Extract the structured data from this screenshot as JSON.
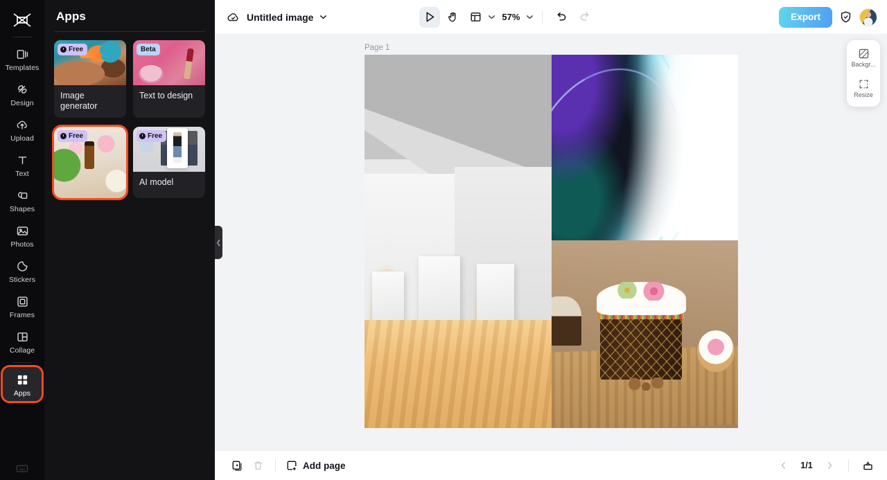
{
  "rail": {
    "logo_icon": "capcut-logo-icon",
    "items": [
      {
        "label": "Templates",
        "icon": "templates-icon"
      },
      {
        "label": "Design",
        "icon": "design-icon"
      },
      {
        "label": "Upload",
        "icon": "upload-cloud-icon"
      },
      {
        "label": "Text",
        "icon": "text-icon"
      },
      {
        "label": "Shapes",
        "icon": "shapes-icon"
      },
      {
        "label": "Photos",
        "icon": "photos-icon"
      },
      {
        "label": "Stickers",
        "icon": "stickers-icon"
      },
      {
        "label": "Frames",
        "icon": "frames-icon"
      },
      {
        "label": "Collage",
        "icon": "collage-icon"
      },
      {
        "label": "Apps",
        "icon": "apps-grid-icon"
      }
    ],
    "active_label": "Apps",
    "keyboard_icon": "keyboard-icon",
    "highlight_color": "#f54a20"
  },
  "panel": {
    "title": "Apps",
    "collapse_icon": "chevron-left-icon",
    "cards": [
      {
        "label": "Image generator",
        "badge": "Free",
        "badge_type": "free",
        "selected": false
      },
      {
        "label": "Text to design",
        "badge": "Beta",
        "badge_type": "beta",
        "selected": false
      },
      {
        "label": "",
        "badge": "Free",
        "badge_type": "free",
        "selected": true
      },
      {
        "label": "AI model",
        "badge": "Free",
        "badge_type": "free",
        "selected": false
      }
    ]
  },
  "topbar": {
    "cloud_icon": "cloud-saved-icon",
    "doc_title": "Untitled image",
    "title_chevron_icon": "chevron-down-icon",
    "tools": [
      {
        "name": "select-tool",
        "icon": "cursor-arrow-icon",
        "active": true
      },
      {
        "name": "hand-tool",
        "icon": "hand-icon",
        "active": false
      },
      {
        "name": "layout-tool",
        "icon": "layout-grid-icon",
        "active": false
      }
    ],
    "layout_chevron_icon": "chevron-down-icon",
    "zoom_value": "57%",
    "zoom_chevron_icon": "chevron-down-icon",
    "undo_icon": "undo-icon",
    "redo_icon": "redo-icon",
    "export_label": "Export",
    "shield_icon": "shield-check-icon",
    "avatar_icon": "user-avatar",
    "export_gradient_from": "#5ed7ec",
    "export_gradient_to": "#4e9ff2"
  },
  "canvas": {
    "page_label": "Page 1",
    "photos": [
      {
        "name": "interior-gallery-photo",
        "alt": "modern gallery interior with wood floor"
      },
      {
        "name": "abstract-waves-photo",
        "alt": "blue green abstract light waves"
      },
      {
        "name": "easter-cake-photo",
        "alt": "decorated easter kulich cake on wood board"
      }
    ]
  },
  "float_panel": {
    "items": [
      {
        "label": "Backgr...",
        "icon": "background-icon"
      },
      {
        "label": "Resize",
        "icon": "resize-icon"
      }
    ]
  },
  "bottombar": {
    "duplicate_icon": "duplicate-page-icon",
    "delete_icon": "trash-icon",
    "add_page_icon": "add-page-icon",
    "add_page_label": "Add page",
    "prev_icon": "chevron-left-icon",
    "page_indicator": "1/1",
    "next_icon": "chevron-right-icon",
    "present_icon": "present-icon"
  }
}
